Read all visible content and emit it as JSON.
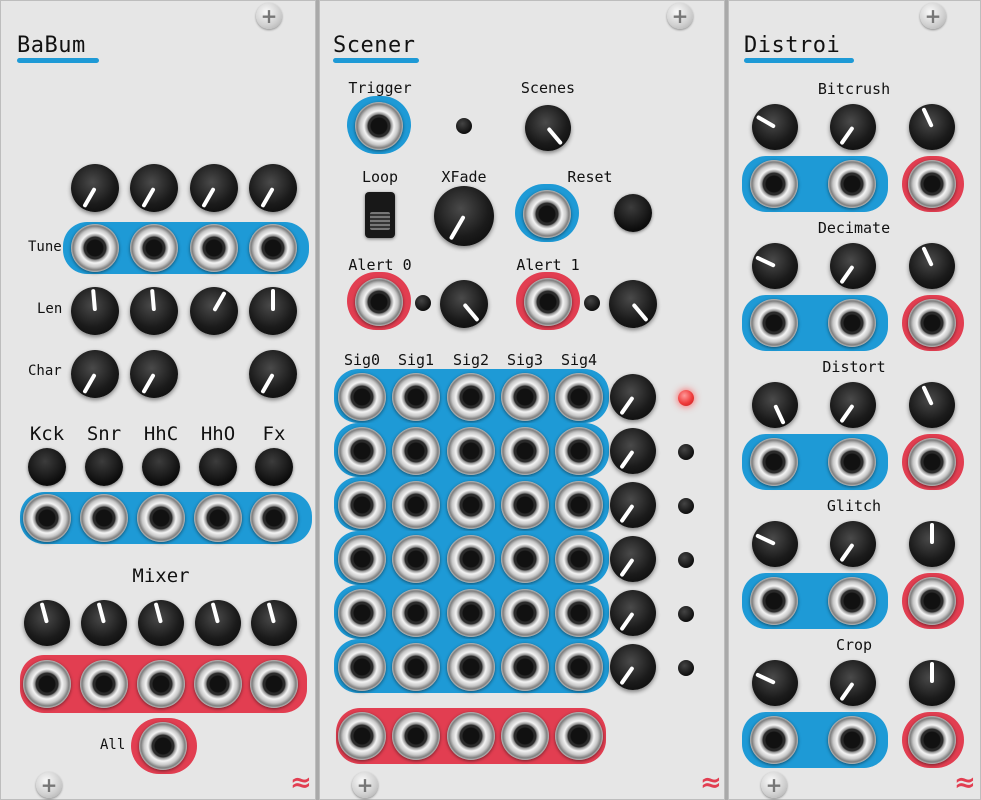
{
  "colors": {
    "blue_band": "#1e9ad6",
    "red_band": "#e23e51",
    "panel": "#e6e6e6",
    "led_on": "#ef3b3b"
  },
  "icons": {
    "screw": "screw-icon",
    "logo": "logo-icon"
  },
  "babum": {
    "title": "BaBum",
    "row_labels": {
      "tune": "Tune",
      "len": "Len",
      "char": "Char"
    },
    "triggers": [
      "Kck",
      "Snr",
      "HhC",
      "HhO",
      "Fx"
    ],
    "mixer_label": "Mixer",
    "all_label": "All"
  },
  "scener": {
    "title": "Scener",
    "trigger": "Trigger",
    "scenes": "Scenes",
    "loop": "Loop",
    "xfade": "XFade",
    "reset": "Reset",
    "alert0": "Alert 0",
    "alert1": "Alert 1",
    "sig_labels": [
      "Sig0",
      "Sig1",
      "Sig2",
      "Sig3",
      "Sig4"
    ],
    "active_scene_index": 0
  },
  "distroi": {
    "title": "Distroi",
    "sections": [
      "Bitcrush",
      "Decimate",
      "Distort",
      "Glitch",
      "Crop"
    ]
  },
  "logo_glyph": "≈",
  "screw_glyph": "+"
}
